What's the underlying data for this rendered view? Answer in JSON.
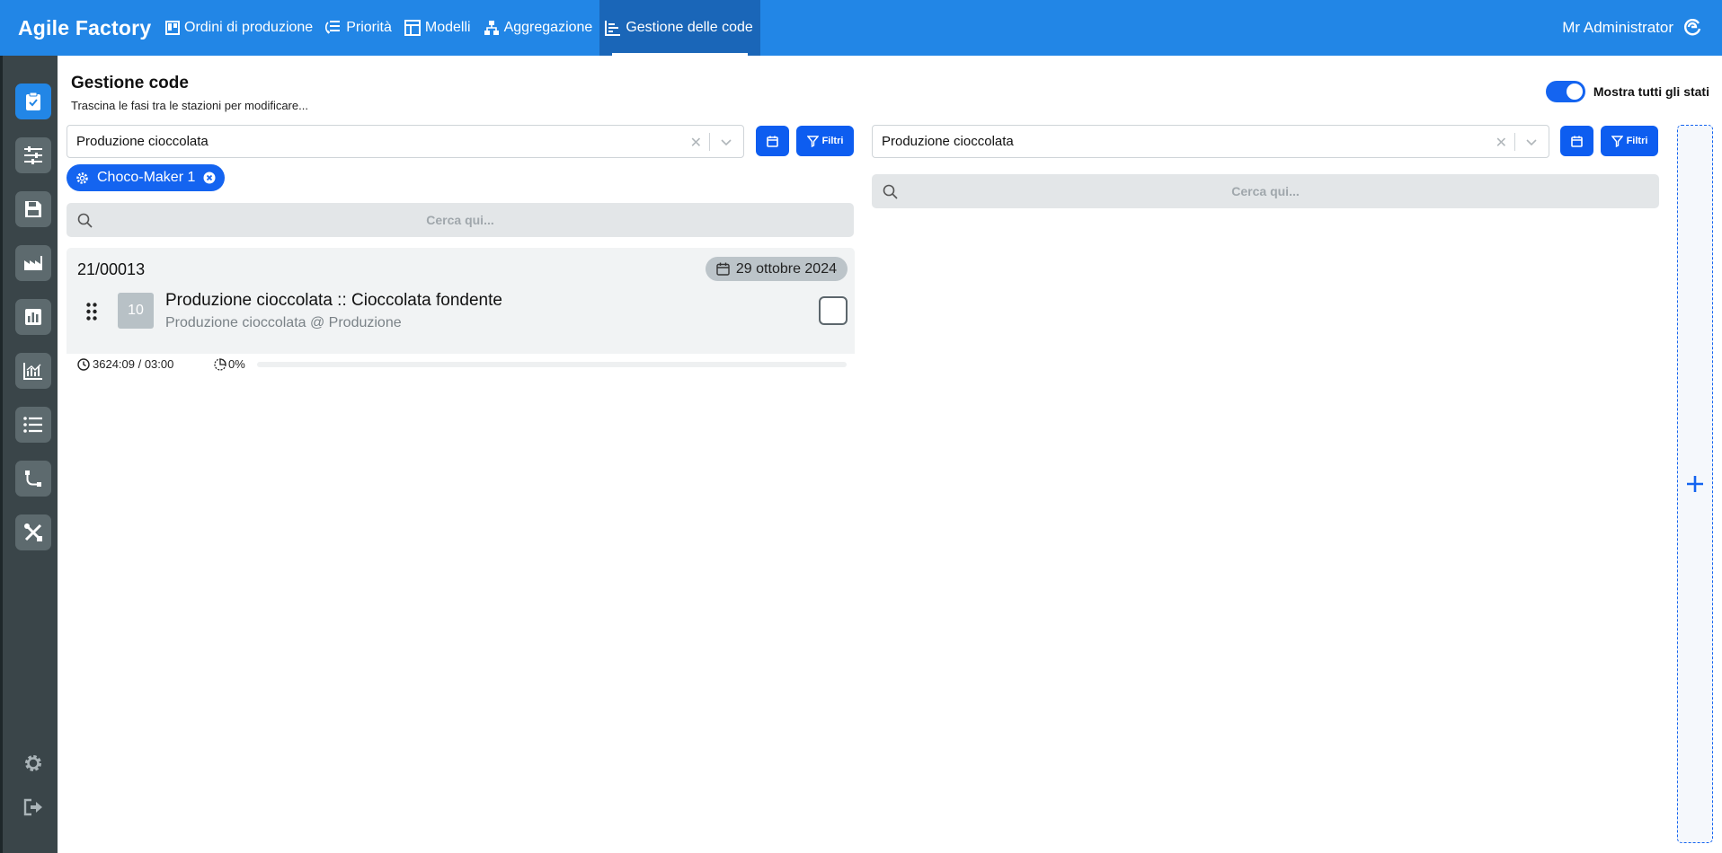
{
  "app": {
    "brand": "Agile Factory",
    "nav": [
      {
        "label": "Ordini di produzione",
        "icon": "board-icon"
      },
      {
        "label": "Priorità",
        "icon": "priority-list-icon"
      },
      {
        "label": "Modelli",
        "icon": "layout-icon"
      },
      {
        "label": "Aggregazione",
        "icon": "hierarchy-icon"
      },
      {
        "label": "Gestione delle code",
        "icon": "queue-chart-icon"
      }
    ],
    "active_nav": "Gestione delle code",
    "user": "Mr Administrator",
    "accent_color": "#2286e6",
    "primary_button_color": "#0d5df0"
  },
  "sidebar": {
    "items": [
      "clipboard-check-icon",
      "sliders-icon",
      "floppy-disk-icon",
      "factory-icon",
      "bar-chart-icon",
      "line-chart-icon",
      "list-icon",
      "workflow-icon",
      "tools-icon"
    ],
    "footer": [
      "gear-icon",
      "logout-icon"
    ]
  },
  "page": {
    "title": "Gestione code",
    "subtitle": "Trascina le fasi tra le stazioni per modificare...",
    "toggle_label": "Mostra tutti gli stati",
    "toggle_on": true
  },
  "left": {
    "select_value": "Produzione cioccolata",
    "filter_label": "Filtri",
    "chip_label": "Choco-Maker 1",
    "search_placeholder": "Cerca qui...",
    "card": {
      "code": "21/00013",
      "date": "29 ottobre 2024",
      "sequence": "10",
      "title": "Produzione cioccolata :: Cioccolata fondente",
      "subtitle": "Produzione cioccolata @ Produzione",
      "time": "3624:09 / 03:00",
      "percent": "0%",
      "progress_fraction": 0
    }
  },
  "right": {
    "select_value": "Produzione cioccolata",
    "filter_label": "Filtri",
    "search_placeholder": "Cerca qui..."
  }
}
